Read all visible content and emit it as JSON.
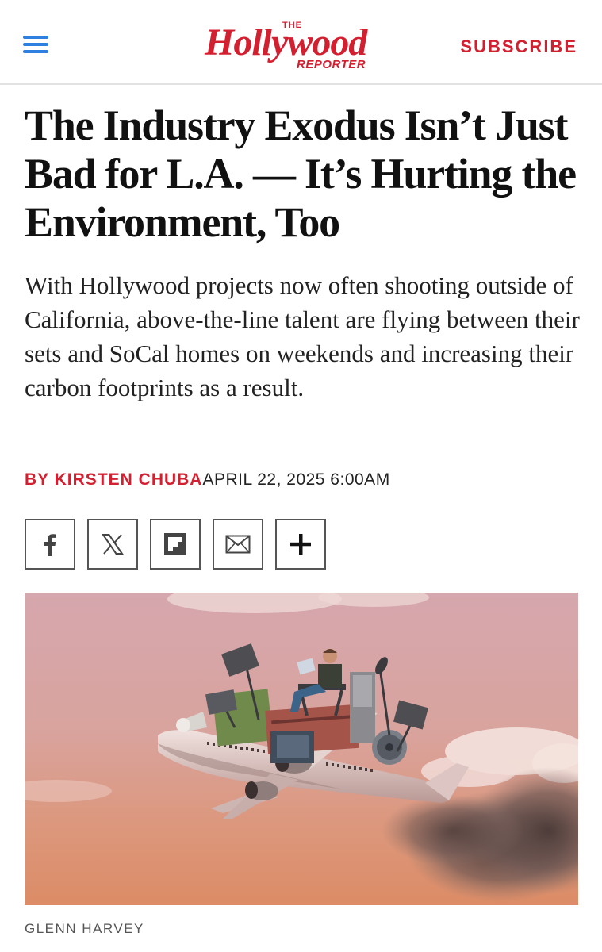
{
  "header": {
    "menu_icon": "hamburger-menu-icon",
    "logo": {
      "the": "THE",
      "main": "Hollywood",
      "reporter": "REPORTER"
    },
    "subscribe_label": "SUBSCRIBE"
  },
  "article": {
    "headline": "The Industry Exodus Isn’t Just Bad for L.A. — It’s Hurting the Environment, Too",
    "dek": "With Hollywood projects now often shooting outside of California, above-the-line talent are flying between their sets and SoCal homes on weekends and increasing their carbon footprints as a result.",
    "byline_prefix": "BY ",
    "author": "KIRSTEN CHUBA",
    "date": "APRIL 22, 2025 6:00AM"
  },
  "share": {
    "buttons": [
      {
        "icon": "facebook-icon"
      },
      {
        "icon": "x-twitter-icon"
      },
      {
        "icon": "flipboard-icon"
      },
      {
        "icon": "email-icon"
      },
      {
        "icon": "plus-icon"
      }
    ]
  },
  "hero": {
    "image": "illustration-airplane-with-film-equipment",
    "credit": "GLENN HARVEY"
  },
  "colors": {
    "brand_red": "#d32031",
    "menu_blue": "#2f7fe0",
    "divider": "#e2e2e2"
  }
}
